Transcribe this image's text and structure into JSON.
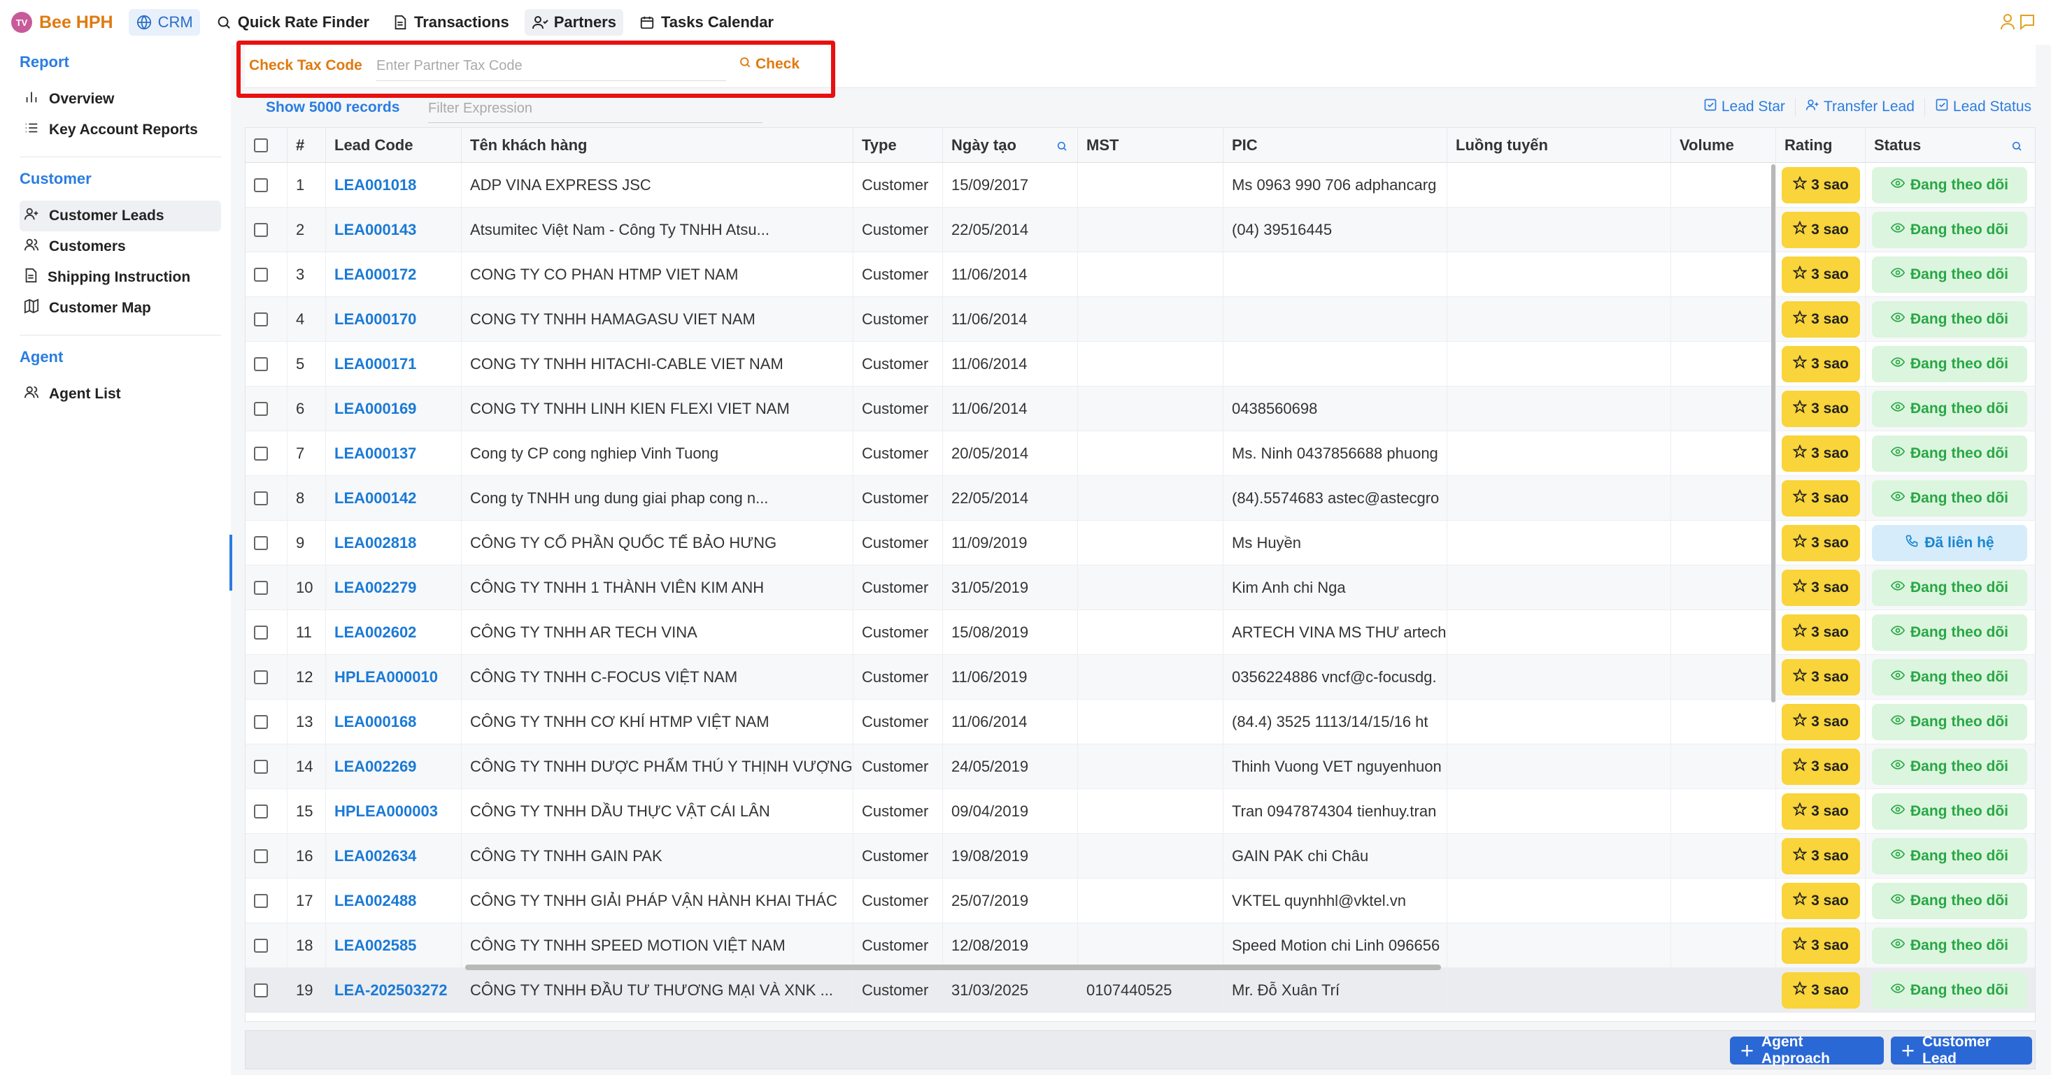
{
  "brand": {
    "logo_text": "TV",
    "name": "Bee HPH"
  },
  "nav": {
    "crm": "CRM",
    "quick_rate": "Quick Rate Finder",
    "transactions": "Transactions",
    "partners": "Partners",
    "tasks": "Tasks Calendar"
  },
  "sidebar": {
    "report_title": "Report",
    "overview": "Overview",
    "key_account": "Key Account Reports",
    "customer_title": "Customer",
    "customer_leads": "Customer Leads",
    "customers": "Customers",
    "shipping": "Shipping Instruction",
    "customer_map": "Customer Map",
    "agent_title": "Agent",
    "agent_list": "Agent List"
  },
  "taxcheck": {
    "label": "Check Tax Code",
    "placeholder": "Enter Partner Tax Code",
    "button": "Check"
  },
  "toolbar": {
    "show_records": "Show 5000 records",
    "filter_placeholder": "Filter Expression",
    "lead_star": "Lead Star",
    "transfer_lead": "Transfer Lead",
    "lead_status": "Lead Status"
  },
  "table": {
    "headers": {
      "num": "#",
      "code": "Lead Code",
      "name": "Tên khách hàng",
      "type": "Type",
      "date": "Ngày tạo",
      "mst": "MST",
      "pic": "PIC",
      "route": "Luồng tuyến",
      "volume": "Volume",
      "rating": "Rating",
      "status": "Status"
    },
    "rows": [
      {
        "num": "1",
        "code": "LEA001018",
        "name": "ADP VINA EXPRESS JSC",
        "type": "Customer",
        "date": "15/09/2017",
        "mst": "",
        "pic": "Ms 0963 990 706 adphancarg",
        "rating": "3 sao",
        "status": "Đang theo dõi",
        "status_kind": "follow"
      },
      {
        "num": "2",
        "code": "LEA000143",
        "name": "Atsumitec Việt Nam - Công Ty TNHH Atsu...",
        "type": "Customer",
        "date": "22/05/2014",
        "mst": "",
        "pic": "(04) 39516445",
        "rating": "3 sao",
        "status": "Đang theo dõi",
        "status_kind": "follow"
      },
      {
        "num": "3",
        "code": "LEA000172",
        "name": "CONG TY CO PHAN HTMP VIET NAM",
        "type": "Customer",
        "date": "11/06/2014",
        "mst": "",
        "pic": "",
        "rating": "3 sao",
        "status": "Đang theo dõi",
        "status_kind": "follow"
      },
      {
        "num": "4",
        "code": "LEA000170",
        "name": "CONG TY TNHH HAMAGASU VIET NAM",
        "type": "Customer",
        "date": "11/06/2014",
        "mst": "",
        "pic": "",
        "rating": "3 sao",
        "status": "Đang theo dõi",
        "status_kind": "follow"
      },
      {
        "num": "5",
        "code": "LEA000171",
        "name": "CONG TY TNHH HITACHI-CABLE VIET NAM",
        "type": "Customer",
        "date": "11/06/2014",
        "mst": "",
        "pic": "",
        "rating": "3 sao",
        "status": "Đang theo dõi",
        "status_kind": "follow"
      },
      {
        "num": "6",
        "code": "LEA000169",
        "name": "CONG TY TNHH LINH KIEN FLEXI VIET NAM",
        "type": "Customer",
        "date": "11/06/2014",
        "mst": "",
        "pic": "0438560698",
        "rating": "3 sao",
        "status": "Đang theo dõi",
        "status_kind": "follow"
      },
      {
        "num": "7",
        "code": "LEA000137",
        "name": "Cong ty CP cong nghiep Vinh Tuong",
        "type": "Customer",
        "date": "20/05/2014",
        "mst": "",
        "pic": "Ms. Ninh 0437856688 phuong",
        "rating": "3 sao",
        "status": "Đang theo dõi",
        "status_kind": "follow"
      },
      {
        "num": "8",
        "code": "LEA000142",
        "name": "Cong ty TNHH ung dung giai phap cong n...",
        "type": "Customer",
        "date": "22/05/2014",
        "mst": "",
        "pic": "(84).5574683 astec@astecgro",
        "rating": "3 sao",
        "status": "Đang theo dõi",
        "status_kind": "follow"
      },
      {
        "num": "9",
        "code": "LEA002818",
        "name": "CÔNG TY CỔ PHẦN QUỐC TẾ BẢO HƯNG",
        "type": "Customer",
        "date": "11/09/2019",
        "mst": "",
        "pic": "Ms Huyền",
        "rating": "3 sao",
        "status": "Đã liên hệ",
        "status_kind": "contact"
      },
      {
        "num": "10",
        "code": "LEA002279",
        "name": "CÔNG TY TNHH 1 THÀNH VIÊN KIM ANH",
        "type": "Customer",
        "date": "31/05/2019",
        "mst": "",
        "pic": "Kim Anh chi Nga",
        "rating": "3 sao",
        "status": "Đang theo dõi",
        "status_kind": "follow"
      },
      {
        "num": "11",
        "code": "LEA002602",
        "name": "CÔNG TY TNHH AR TECH VINA",
        "type": "Customer",
        "date": "15/08/2019",
        "mst": "",
        "pic": "ARTECH VINA MS THƯ artech",
        "rating": "3 sao",
        "status": "Đang theo dõi",
        "status_kind": "follow"
      },
      {
        "num": "12",
        "code": "HPLEA000010",
        "name": "CÔNG TY TNHH C-FOCUS VIỆT NAM",
        "type": "Customer",
        "date": "11/06/2019",
        "mst": "",
        "pic": "0356224886 vncf@c-focusdg.",
        "rating": "3 sao",
        "status": "Đang theo dõi",
        "status_kind": "follow"
      },
      {
        "num": "13",
        "code": "LEA000168",
        "name": "CÔNG TY TNHH CƠ KHÍ HTMP VIỆT NAM",
        "type": "Customer",
        "date": "11/06/2014",
        "mst": "",
        "pic": "(84.4) 3525 1113/14/15/16 ht",
        "rating": "3 sao",
        "status": "Đang theo dõi",
        "status_kind": "follow"
      },
      {
        "num": "14",
        "code": "LEA002269",
        "name": "CÔNG TY TNHH DƯỢC PHẨM THÚ Y THỊNH VƯỢNG",
        "type": "Customer",
        "date": "24/05/2019",
        "mst": "",
        "pic": "Thinh Vuong VET nguyenhuon",
        "rating": "3 sao",
        "status": "Đang theo dõi",
        "status_kind": "follow"
      },
      {
        "num": "15",
        "code": "HPLEA000003",
        "name": "CÔNG TY TNHH DẦU THỰC VẬT CÁI LÂN",
        "type": "Customer",
        "date": "09/04/2019",
        "mst": "",
        "pic": "Tran 0947874304 tienhuy.tran",
        "rating": "3 sao",
        "status": "Đang theo dõi",
        "status_kind": "follow"
      },
      {
        "num": "16",
        "code": "LEA002634",
        "name": "CÔNG TY TNHH GAIN PAK",
        "type": "Customer",
        "date": "19/08/2019",
        "mst": "",
        "pic": "GAIN PAK chi Châu",
        "rating": "3 sao",
        "status": "Đang theo dõi",
        "status_kind": "follow"
      },
      {
        "num": "17",
        "code": "LEA002488",
        "name": "CÔNG TY TNHH GIẢI PHÁP VẬN HÀNH KHAI THÁC",
        "type": "Customer",
        "date": "25/07/2019",
        "mst": "",
        "pic": "VKTEL quynhhl@vktel.vn",
        "rating": "3 sao",
        "status": "Đang theo dõi",
        "status_kind": "follow"
      },
      {
        "num": "18",
        "code": "LEA002585",
        "name": "CÔNG TY TNHH SPEED MOTION VIỆT NAM",
        "type": "Customer",
        "date": "12/08/2019",
        "mst": "",
        "pic": "Speed Motion chi Linh 096656",
        "rating": "3 sao",
        "status": "Đang theo dõi",
        "status_kind": "follow"
      },
      {
        "num": "19",
        "code": "LEA-202503272",
        "name": "CÔNG TY TNHH ĐẦU TƯ THƯƠNG MẠI VÀ XNK ...",
        "type": "Customer",
        "date": "31/03/2025",
        "mst": "0107440525",
        "pic": "Mr. Đỗ Xuân Trí",
        "rating": "3 sao",
        "status": "Đang theo dõi",
        "status_kind": "follow"
      }
    ]
  },
  "footer": {
    "agent_approach": "Agent Approach",
    "customer_lead": "Customer Lead"
  },
  "colors": {
    "accent_blue": "#2a7de1",
    "brand_orange": "#e07a10",
    "rating_yellow": "#f9d43a",
    "status_follow": "#28a745",
    "status_contact": "#1b86d0",
    "highlight_red": "#e81010"
  }
}
